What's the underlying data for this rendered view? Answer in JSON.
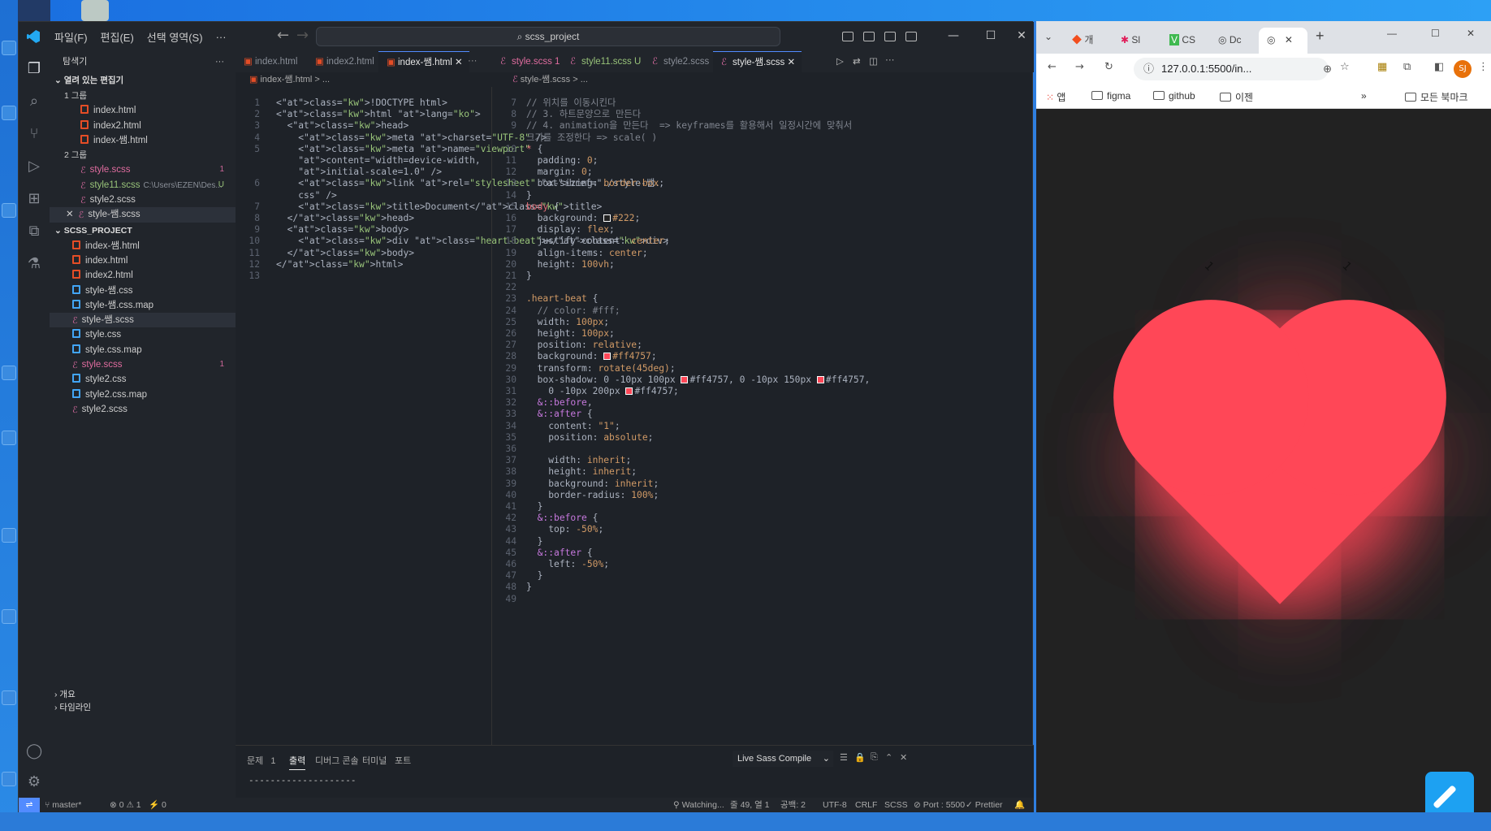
{
  "vscode": {
    "menu": [
      "파일(F)",
      "편집(E)",
      "선택 영역(S)",
      "···"
    ],
    "search": "scss_project",
    "explorer_title": "탐색기",
    "open_editors_title": "열려 있는 편집기",
    "group1_title": "1 그룹",
    "group1": [
      "index.html",
      "index2.html",
      "index-쌤.html"
    ],
    "group2_title": "2 그룹",
    "group2": [
      {
        "name": "style.scss",
        "badge": "1"
      },
      {
        "name": "style11.scss",
        "path": "C:\\Users\\EZEN\\Des...",
        "badge": "U"
      },
      {
        "name": "style2.scss"
      },
      {
        "name": "style-쌤.scss"
      }
    ],
    "project_title": "SCSS_PROJECT",
    "project_files": [
      {
        "name": "index-쌤.html",
        "type": "html"
      },
      {
        "name": "index.html",
        "type": "html"
      },
      {
        "name": "index2.html",
        "type": "html"
      },
      {
        "name": "style-쌤.css",
        "type": "css"
      },
      {
        "name": "style-쌤.css.map",
        "type": "css"
      },
      {
        "name": "style-쌤.scss",
        "type": "scss"
      },
      {
        "name": "style.css",
        "type": "css"
      },
      {
        "name": "style.css.map",
        "type": "css"
      },
      {
        "name": "style.scss",
        "type": "scss",
        "badge": "1"
      },
      {
        "name": "style2.css",
        "type": "css"
      },
      {
        "name": "style2.css.map",
        "type": "css"
      },
      {
        "name": "style2.scss",
        "type": "scss"
      }
    ],
    "outline": "개요",
    "timeline": "타임라인",
    "tabs_left": [
      "index.html",
      "index2.html",
      "index-쌤.html"
    ],
    "tabs_right": [
      "style.scss 1",
      "style11.scss U",
      "style2.scss",
      "style-쌤.scss"
    ],
    "bread_left": "index-쌤.html > ...",
    "bread_right": "style-쌤.scss > ...",
    "html_code": [
      "<!DOCTYPE html>",
      "<html lang=\"ko\">",
      "  <head>",
      "    <meta charset=\"UTF-8\" />",
      "    <meta name=\"viewport\"",
      "    content=\"width=device-width,",
      "    initial-scale=1.0\" />",
      "    <link rel=\"stylesheet\" href=\"./style-쌤.",
      "    css\" />",
      "    <title>Document</title>",
      "  </head>",
      "  <body>",
      "    <div class=\"heart-beat\"></div>",
      "  </body>",
      "</html>",
      ""
    ],
    "html_line_numbers": [
      "1",
      "2",
      "3",
      "4",
      "5",
      "",
      "",
      "6",
      "",
      "7",
      "8",
      "9",
      "10",
      "11",
      "12",
      "13"
    ],
    "scss_code": [
      "// 위치를 이동시킨다",
      "// 3. 하트문양으로 만든다",
      "// 4. animation을 만든다  => keyframes를 활용해서 일정시간에 맞춰서",
      "크기를 조정한다 => scale( )",
      "* {",
      "  padding: 0;",
      "  margin: 0;",
      "  box-sizing: border-box;",
      "}",
      "body {",
      "  background: #222;",
      "  display: flex;",
      "  justify-content: center;",
      "  align-items: center;",
      "  height: 100vh;",
      "}",
      "",
      ".heart-beat {",
      "  // color: #fff;",
      "  width: 100px;",
      "  height: 100px;",
      "  position: relative;",
      "  background: #ff4757;",
      "  transform: rotate(45deg);",
      "  box-shadow: 0 -10px 100px #ff4757, 0 -10px 150px #ff4757,",
      "    0 -10px 200px #ff4757;",
      "  &::before,",
      "  &::after {",
      "    content: \"1\";",
      "    position: absolute;",
      "",
      "    width: inherit;",
      "    height: inherit;",
      "    background: inherit;",
      "    border-radius: 100%;",
      "  }",
      "  &::before {",
      "    top: -50%;",
      "  }",
      "  &::after {",
      "    left: -50%;",
      "  }",
      "}",
      ""
    ],
    "scss_line_numbers": [
      "7",
      "8",
      "9",
      "",
      "10",
      "11",
      "12",
      "13",
      "14",
      "15",
      "16",
      "17",
      "18",
      "19",
      "20",
      "21",
      "22",
      "23",
      "24",
      "25",
      "26",
      "27",
      "28",
      "29",
      "30",
      "31",
      "32",
      "33",
      "34",
      "35",
      "36",
      "37",
      "38",
      "39",
      "40",
      "41",
      "42",
      "43",
      "44",
      "45",
      "46",
      "47",
      "48",
      "49"
    ],
    "panel_tabs": [
      "문제",
      "출력",
      "디버그 콘솔",
      "터미널",
      "포트"
    ],
    "problems_count": "1",
    "panel_output": "--------------------",
    "panel_select": "Live Sass Compile",
    "status": {
      "branch": "master*",
      "errors": "⊗ 0 ⚠ 1",
      "ports": "⚡ 0",
      "watching": "Watching...",
      "cursor": "줄 49, 열 1",
      "spaces": "공백: 2",
      "encoding": "UTF-8",
      "eol": "CRLF",
      "lang": "SCSS",
      "port": "Port : 5500",
      "prettier": "✓ Prettier"
    }
  },
  "chrome": {
    "tabs": [
      "개",
      "Sl",
      "CS",
      "Dc",
      ""
    ],
    "url": "127.0.0.1:5500/in...",
    "bookmarks": [
      "앱",
      "figma",
      "github",
      "이젠"
    ],
    "all_bookmarks": "모든 북마크",
    "profile": "SJ",
    "heart_color": "#ff4757",
    "page_bg": "#222222",
    "pseudo_content": "1"
  }
}
